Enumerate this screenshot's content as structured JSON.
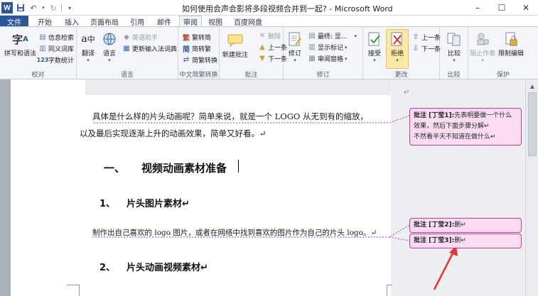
{
  "window": {
    "title": "如何使用会声会影将多段视频合并到一起? - Microsoft Word",
    "minimize": "–",
    "maximize": "☐",
    "close": "✕"
  },
  "qat": {
    "logo": "W"
  },
  "tabs": [
    {
      "label": "文件"
    },
    {
      "label": "开始"
    },
    {
      "label": "插入"
    },
    {
      "label": "页面布局"
    },
    {
      "label": "引用"
    },
    {
      "label": "邮件"
    },
    {
      "label": "审阅"
    },
    {
      "label": "视图"
    },
    {
      "label": "百度网盘"
    }
  ],
  "ribbon": {
    "proofing": {
      "label": "校对",
      "spell": "拼写和语法",
      "research": "信息检索",
      "thesaurus": "同义词库",
      "wordcount": "字数统计"
    },
    "language": {
      "label": "语言",
      "translate": "翻译",
      "language": "语言",
      "english_assistant": "英语助手",
      "update_ime": "更新输入法词典"
    },
    "chinese": {
      "label": "中文简繁转换",
      "to_simplified": "繁转简",
      "to_traditional": "简转繁",
      "convert": "简繁转换"
    },
    "comments": {
      "label": "批注",
      "new": "新建批注",
      "delete": "删除",
      "previous": "上一条",
      "next": "下一条"
    },
    "tracking": {
      "label": "修订",
      "track": "修订",
      "final": "最终: 显...",
      "show_markup": "显示标记",
      "reviewing_pane": "审阅窗格"
    },
    "changes": {
      "label": "更改",
      "accept": "接受",
      "reject": "拒绝",
      "previous": "上一条",
      "next": "下一条"
    },
    "compare": {
      "label": "比较",
      "compare": "比较"
    },
    "protect": {
      "label": "保护",
      "block_authors": "阻止作者",
      "restrict": "限制编辑"
    }
  },
  "document": {
    "para1_line1": "具体是什么样的片头动画呢？简单来说，就是一个 LOGO 从无到有的缩放，",
    "para1_line2": "以及最后实现逐渐上升的动画效果，简单又好看。↵",
    "heading1_num": "一、",
    "heading1_text": "视频动画素材准备",
    "heading2a_num": "1、",
    "heading2a_text": "片头图片素材↵",
    "para2": "制作出自己喜欢的 logo 图片，或者在网络中找到喜欢的图片作为自己的片头 logo。↵",
    "heading2b_num": "2、",
    "heading2b_text": "片头动画视频素材↵",
    "top_mark": "↵"
  },
  "comments": [
    {
      "label": "批注 [丁莹1]:",
      "line1": "先表明要做一个什么",
      "line2": "效果，然后下面步骤分解↵",
      "line3": "不然看半天不知道在做什么↵"
    },
    {
      "label": "批注 [丁莹2]:",
      "text": "删↵"
    },
    {
      "label": "批注 [丁莹3]:",
      "text": "删↵"
    }
  ],
  "colors": {
    "accent": "#2b5797",
    "comment_border": "#c2399b",
    "comment_fill": "#fcdcf2",
    "arrow": "#e8322b"
  }
}
